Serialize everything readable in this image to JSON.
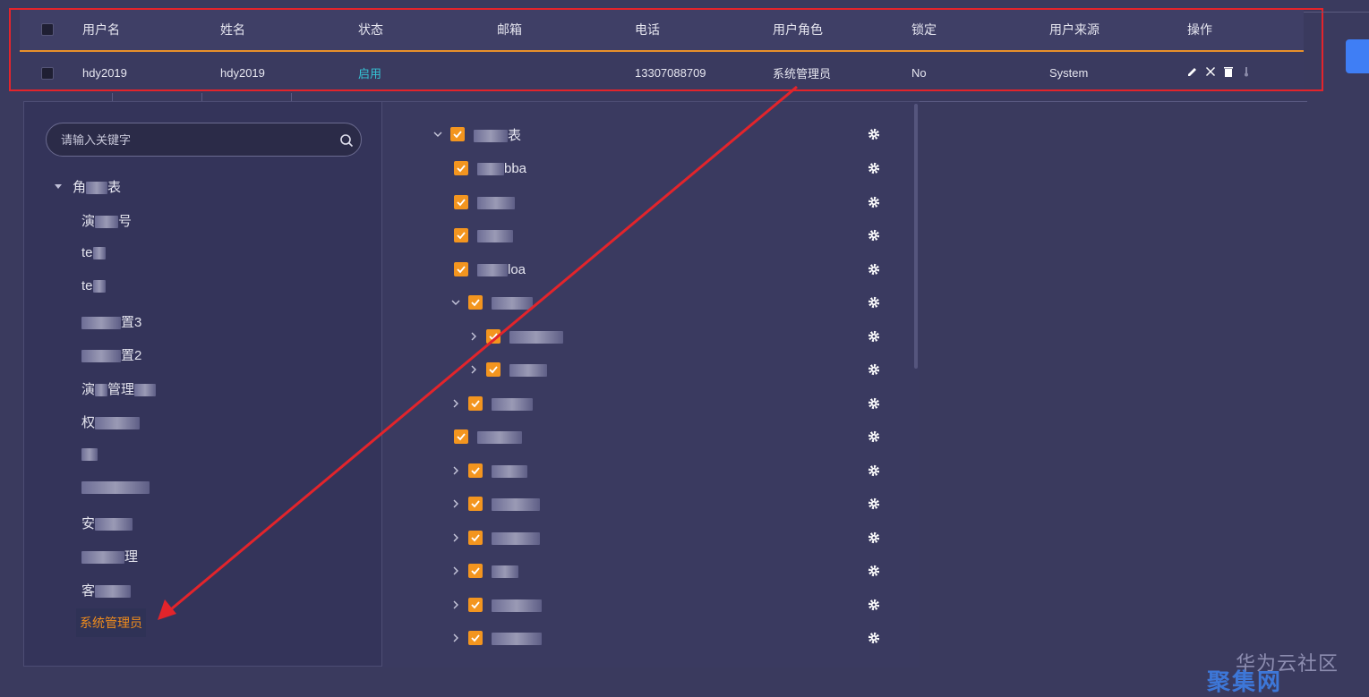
{
  "table": {
    "headers": {
      "username": "用户名",
      "fullname": "姓名",
      "status": "状态",
      "email": "邮箱",
      "phone": "电话",
      "role": "用户角色",
      "locked": "锁定",
      "source": "用户来源",
      "actions": "操作"
    },
    "row": {
      "username": "hdy2019",
      "fullname": "hdy2019",
      "status": "启用",
      "email": "",
      "phone": "13307088709",
      "role": "系统管理员",
      "locked": "No",
      "source": "System"
    },
    "action_icons": [
      "edit-icon",
      "tools-icon",
      "delete-icon",
      "thermometer-icon"
    ]
  },
  "left_panel": {
    "search_placeholder": "请输入关键字",
    "root_label": "角",
    "root_label_tail": "表",
    "items": [
      {
        "prefix": "演",
        "suffix": "号"
      },
      {
        "prefix": "te",
        "suffix": ""
      },
      {
        "prefix": "te",
        "suffix": ""
      },
      {
        "prefix": "",
        "suffix": "置3"
      },
      {
        "prefix": "",
        "suffix": "置2"
      },
      {
        "prefix": "演",
        "suffix": "管理"
      },
      {
        "prefix": "权",
        "suffix": ""
      },
      {
        "prefix": "",
        "suffix": ""
      },
      {
        "prefix": "",
        "suffix": ""
      },
      {
        "prefix": "安",
        "suffix": ""
      },
      {
        "prefix": "",
        "suffix": "理"
      },
      {
        "prefix": "客",
        "suffix": ""
      }
    ],
    "selected_item": "系统管理员"
  },
  "menu_tree": {
    "rows": [
      {
        "label": "表"
      },
      {
        "label": "bba"
      },
      {
        "label": ""
      },
      {
        "label": ""
      },
      {
        "label": "loa"
      },
      {
        "label": ""
      },
      {
        "label": ""
      },
      {
        "label": ""
      },
      {
        "label": ""
      },
      {
        "label": ""
      },
      {
        "label": ""
      },
      {
        "label": ""
      },
      {
        "label": ""
      },
      {
        "label": ""
      },
      {
        "label": ""
      },
      {
        "label": ""
      }
    ]
  },
  "watermark": {
    "line1": "华为云社区",
    "line2": "聚集网"
  },
  "colors": {
    "accent_orange": "#f3951f",
    "status_cyan": "#35c4d6",
    "highlight_red": "#e3242b",
    "button_blue": "#3f7ef5"
  }
}
